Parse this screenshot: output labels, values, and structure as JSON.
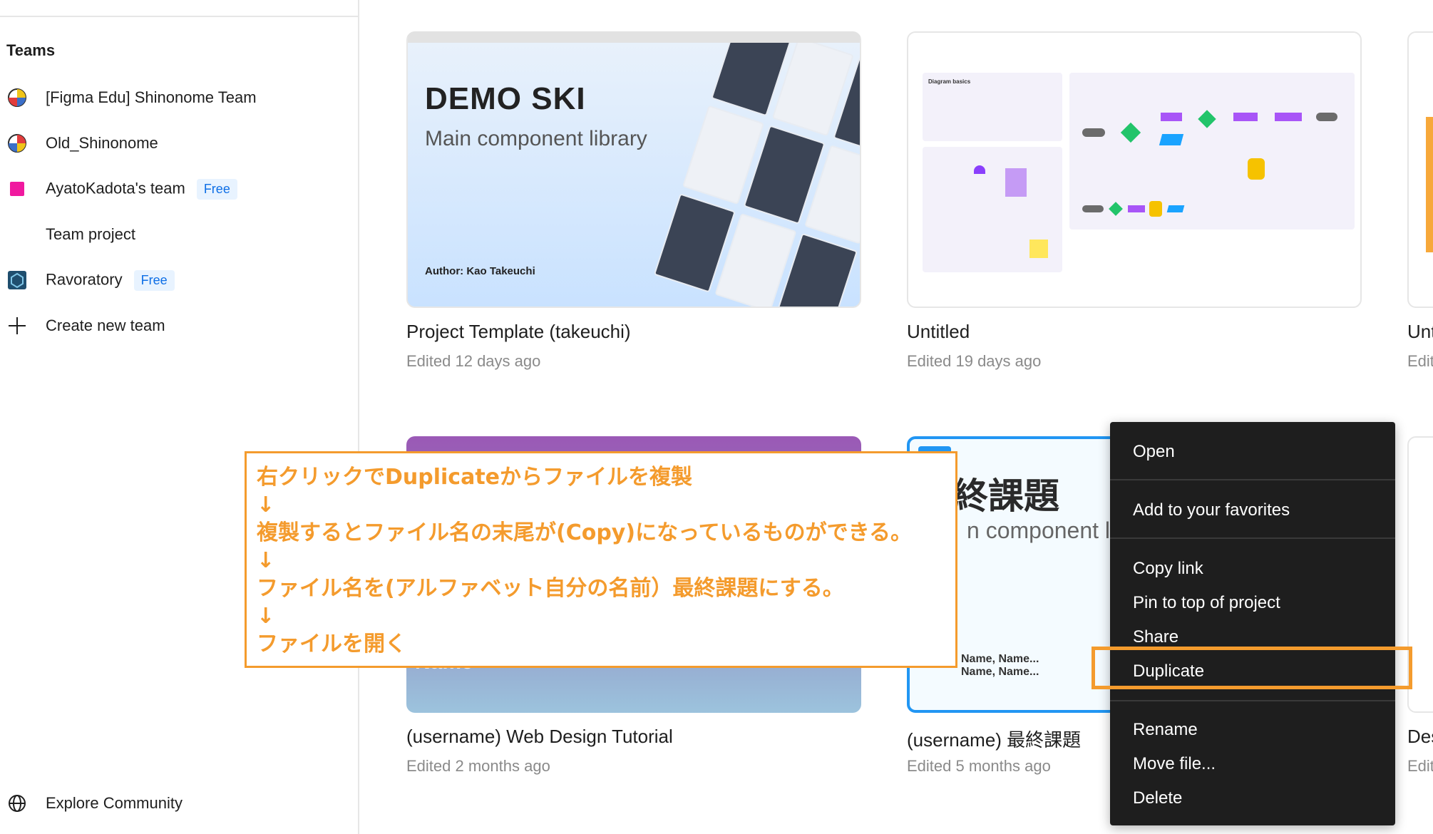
{
  "sidebar": {
    "teams_heading": "Teams",
    "teams": [
      {
        "name": "[Figma Edu] Shinonome Team",
        "badge": ""
      },
      {
        "name": "Old_Shinonome",
        "badge": ""
      },
      {
        "name": "AyatoKadota's team",
        "badge": "Free"
      },
      {
        "name": "Team project",
        "badge": ""
      },
      {
        "name": "Ravoratory",
        "badge": "Free"
      }
    ],
    "create_team": "Create new team",
    "explore_community": "Explore Community"
  },
  "files": [
    {
      "title": "Project Template (takeuchi)",
      "edited": "Edited 12 days ago",
      "thumb_title": "DEMO SKI",
      "thumb_subtitle": "Main component library",
      "thumb_author": "Author: Kao Takeuchi"
    },
    {
      "title": "Untitled",
      "edited": "Edited 19 days ago",
      "thumb_heading": "Diagram basics"
    },
    {
      "title": "Unt",
      "edited": "Edit"
    },
    {
      "title": "(username) Web Design Tutorial",
      "edited": "Edited 2 months ago",
      "thumb_text": "Name"
    },
    {
      "title": "(username) 最終課題",
      "edited": "Edited 5 months ago",
      "thumb_title": "終課題",
      "thumb_subtitle": "n component li",
      "thumb_names": [
        "Name, Name...",
        "Name, Name..."
      ]
    },
    {
      "title": "Des",
      "edited": "Edit"
    }
  ],
  "callout": {
    "lines": [
      "右クリックでDuplicateからファイルを複製",
      "↓",
      "複製するとファイル名の末尾が(Copy)になっているものができる。",
      "↓",
      "ファイル名を(アルファベット自分の名前）最終課題にする。",
      "↓",
      "ファイルを開く"
    ]
  },
  "context_menu": {
    "items": [
      "Open",
      "Add to your favorites",
      "Copy link",
      "Pin to top of project",
      "Share",
      "Duplicate",
      "Rename",
      "Move file...",
      "Delete"
    ]
  },
  "colors": {
    "accent_orange": "#f49b2d",
    "menu_bg": "#1e1e1e",
    "badge_blue": "#0d6ee6",
    "badge_bg": "#e8f3ff"
  },
  "icons": {
    "team_0": "team-avatar-icon",
    "team_1": "team-avatar-icon",
    "team_2": "team-pink-square-icon",
    "team_4": "ravoratory-logo-icon",
    "create": "plus-icon",
    "explore": "globe-icon"
  }
}
